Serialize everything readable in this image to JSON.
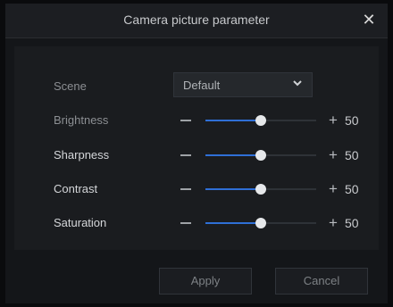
{
  "dialog": {
    "title": "Camera picture parameter",
    "close_icon": "close-icon"
  },
  "scene": {
    "label": "Scene",
    "value": "Default",
    "dropdown_icon": "chevron-down-icon"
  },
  "sliders": [
    {
      "label": "Brightness",
      "value": "50",
      "level": 0.5
    },
    {
      "label": "Sharpness",
      "value": "50",
      "level": 0.5
    },
    {
      "label": "Contrast",
      "value": "50",
      "level": 0.5
    },
    {
      "label": "Saturation",
      "value": "50",
      "level": 0.5
    }
  ],
  "controls": {
    "minus": "−",
    "plus": "+"
  },
  "buttons": {
    "apply": "Apply",
    "cancel": "Cancel"
  },
  "colors": {
    "slider_fill": "#2f6fd6",
    "thumb": "#e6e8ea"
  }
}
